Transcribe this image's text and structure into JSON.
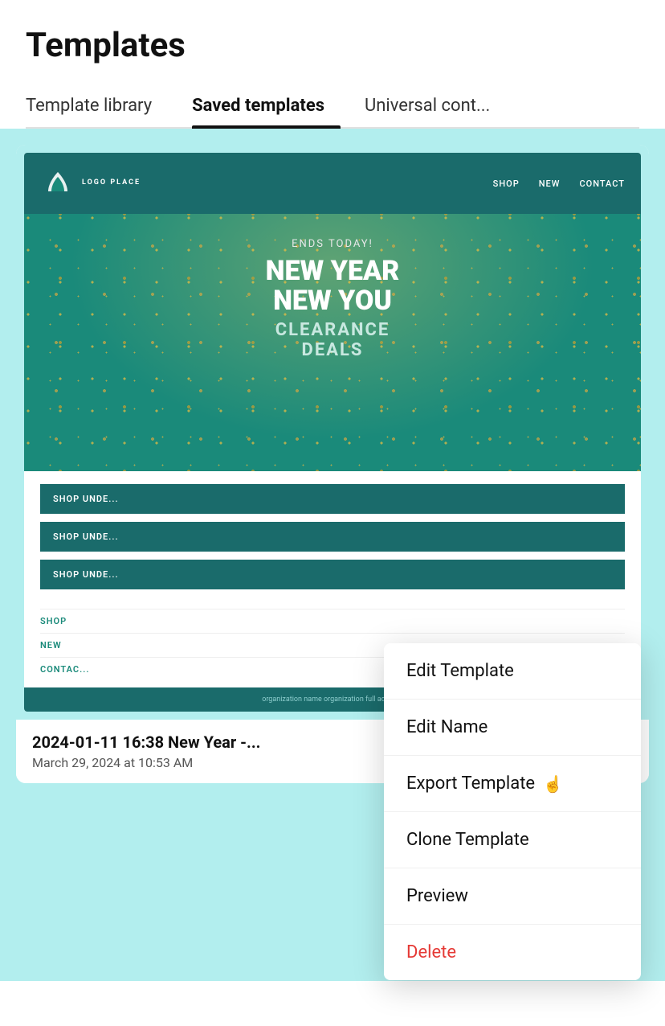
{
  "page": {
    "title": "Templates"
  },
  "tabs": [
    {
      "id": "template-library",
      "label": "Template library",
      "active": false
    },
    {
      "id": "saved-templates",
      "label": "Saved templates",
      "active": true
    },
    {
      "id": "universal-content",
      "label": "Universal cont...",
      "active": false
    }
  ],
  "email_preview": {
    "nav_items": [
      "SHOP",
      "NEW",
      "CONTACT"
    ],
    "logo_text": "LOGO PLACE",
    "ends_today": "ENDS TODAY!",
    "hero_line1": "NEW YEAR",
    "hero_line2": "NEW YOU",
    "hero_line3": "CLEARANCE",
    "hero_line4": "DEALS",
    "shop_buttons": [
      "SHOP UNDE...",
      "SHOP UNDE...",
      "SHOP UNDE..."
    ],
    "footer_links": [
      "SHOP",
      "NEW",
      "CONTAC..."
    ],
    "footer_bar": "organization name organization full address"
  },
  "template_card": {
    "name": "2024-01-11 16:38 New Year -...",
    "date": "March 29, 2024 at 10:53 AM"
  },
  "context_menu": {
    "items": [
      {
        "id": "edit-template",
        "label": "Edit Template",
        "color": "normal"
      },
      {
        "id": "edit-name",
        "label": "Edit Name",
        "color": "normal"
      },
      {
        "id": "export-template",
        "label": "Export Template",
        "color": "normal",
        "has_cursor": true
      },
      {
        "id": "clone-template",
        "label": "Clone Template",
        "color": "normal"
      },
      {
        "id": "preview",
        "label": "Preview",
        "color": "normal"
      },
      {
        "id": "delete",
        "label": "Delete",
        "color": "delete"
      }
    ]
  }
}
